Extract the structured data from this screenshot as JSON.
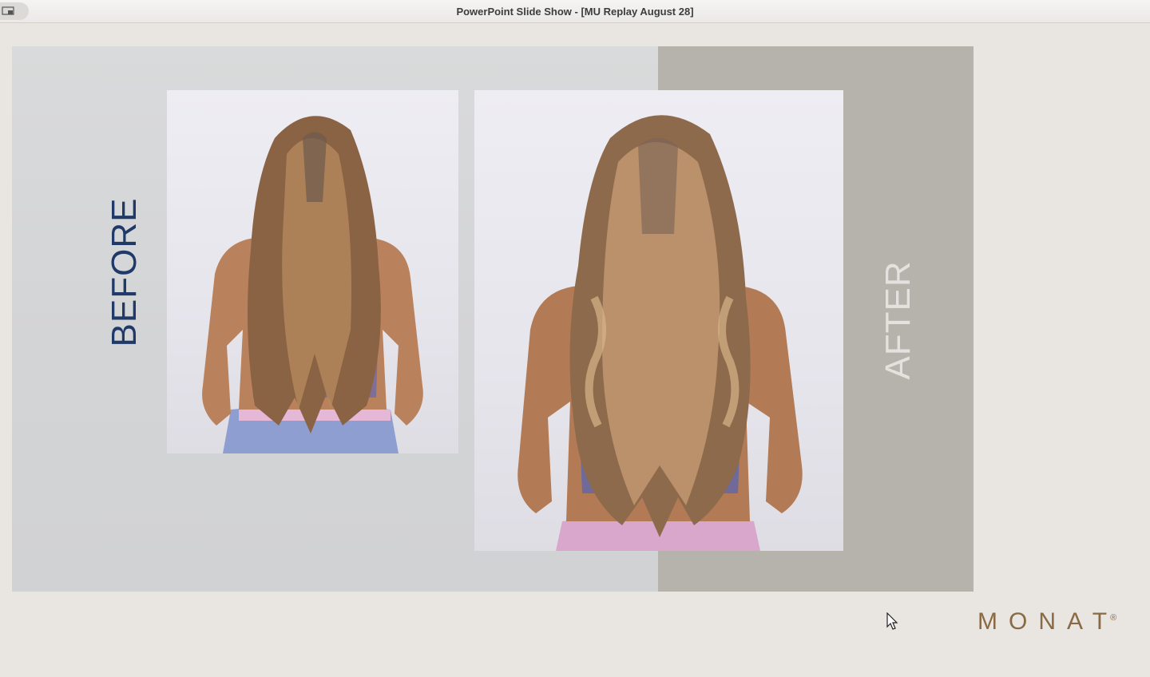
{
  "window": {
    "title": "PowerPoint Slide Show - [MU Replay August 28]"
  },
  "slide": {
    "before_label": "BEFORE",
    "after_label": "AFTER",
    "logo_text": "MONAT",
    "logo_mark": "®"
  },
  "colors": {
    "before_label": "#1f3a68",
    "after_label": "#e4e2de",
    "logo": "#8a6a45",
    "right_band": "#b6b3ad"
  },
  "icons": {
    "window_control": "presenter-view-icon",
    "cursor": "mouse-pointer-icon"
  }
}
